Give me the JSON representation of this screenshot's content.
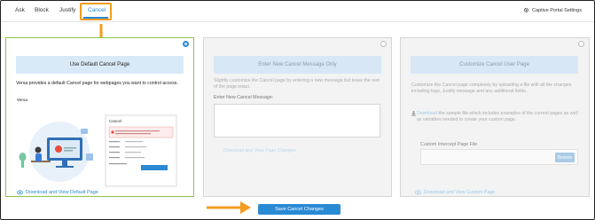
{
  "tabs": [
    {
      "label": "Ask"
    },
    {
      "label": "Block"
    },
    {
      "label": "Justify"
    },
    {
      "label": "Cancel",
      "active": true
    }
  ],
  "header": {
    "settings_label": "Captive Portal Settings"
  },
  "options": {
    "default": {
      "title": "Use Default Cancel Page",
      "description": "Versa provides a default Cancel page for webpages you want to control access.",
      "logo_text": "Versa",
      "preview_title": "Cancel",
      "link": "Download and View Default Page",
      "selected": true
    },
    "message": {
      "title": "Enter New Cancel Message Only",
      "description": "Slightly customize the Cancel page by entering a new message but leave the rest of the page intact.",
      "field_label": "Enter New Cancel Message:",
      "field_value": "",
      "link": "Download and View Page Changes",
      "selected": false
    },
    "custom": {
      "title": "Customize Cancel User Page",
      "description": "Customize the Cancel page completely by uploading a file with all the changes including logo, Justify message and any additional fields.",
      "download_link": "Download",
      "download_text": " the sample file which includes examples of the current pages as well as variables needed to create your custom page.",
      "file_label": "Custom Intercept Page File",
      "browse_label": "Browse",
      "link": "Download and View Custom Page",
      "selected": false
    }
  },
  "footer": {
    "save_label": "Save Cancel Changes"
  },
  "colors": {
    "accent": "#2a8ad4",
    "highlight": "#f39c1f",
    "selected_border": "#8bc34a"
  },
  "icons": [
    "gear-icon",
    "eye-icon",
    "download-icon",
    "arrow-down-icon",
    "arrow-right-icon"
  ]
}
